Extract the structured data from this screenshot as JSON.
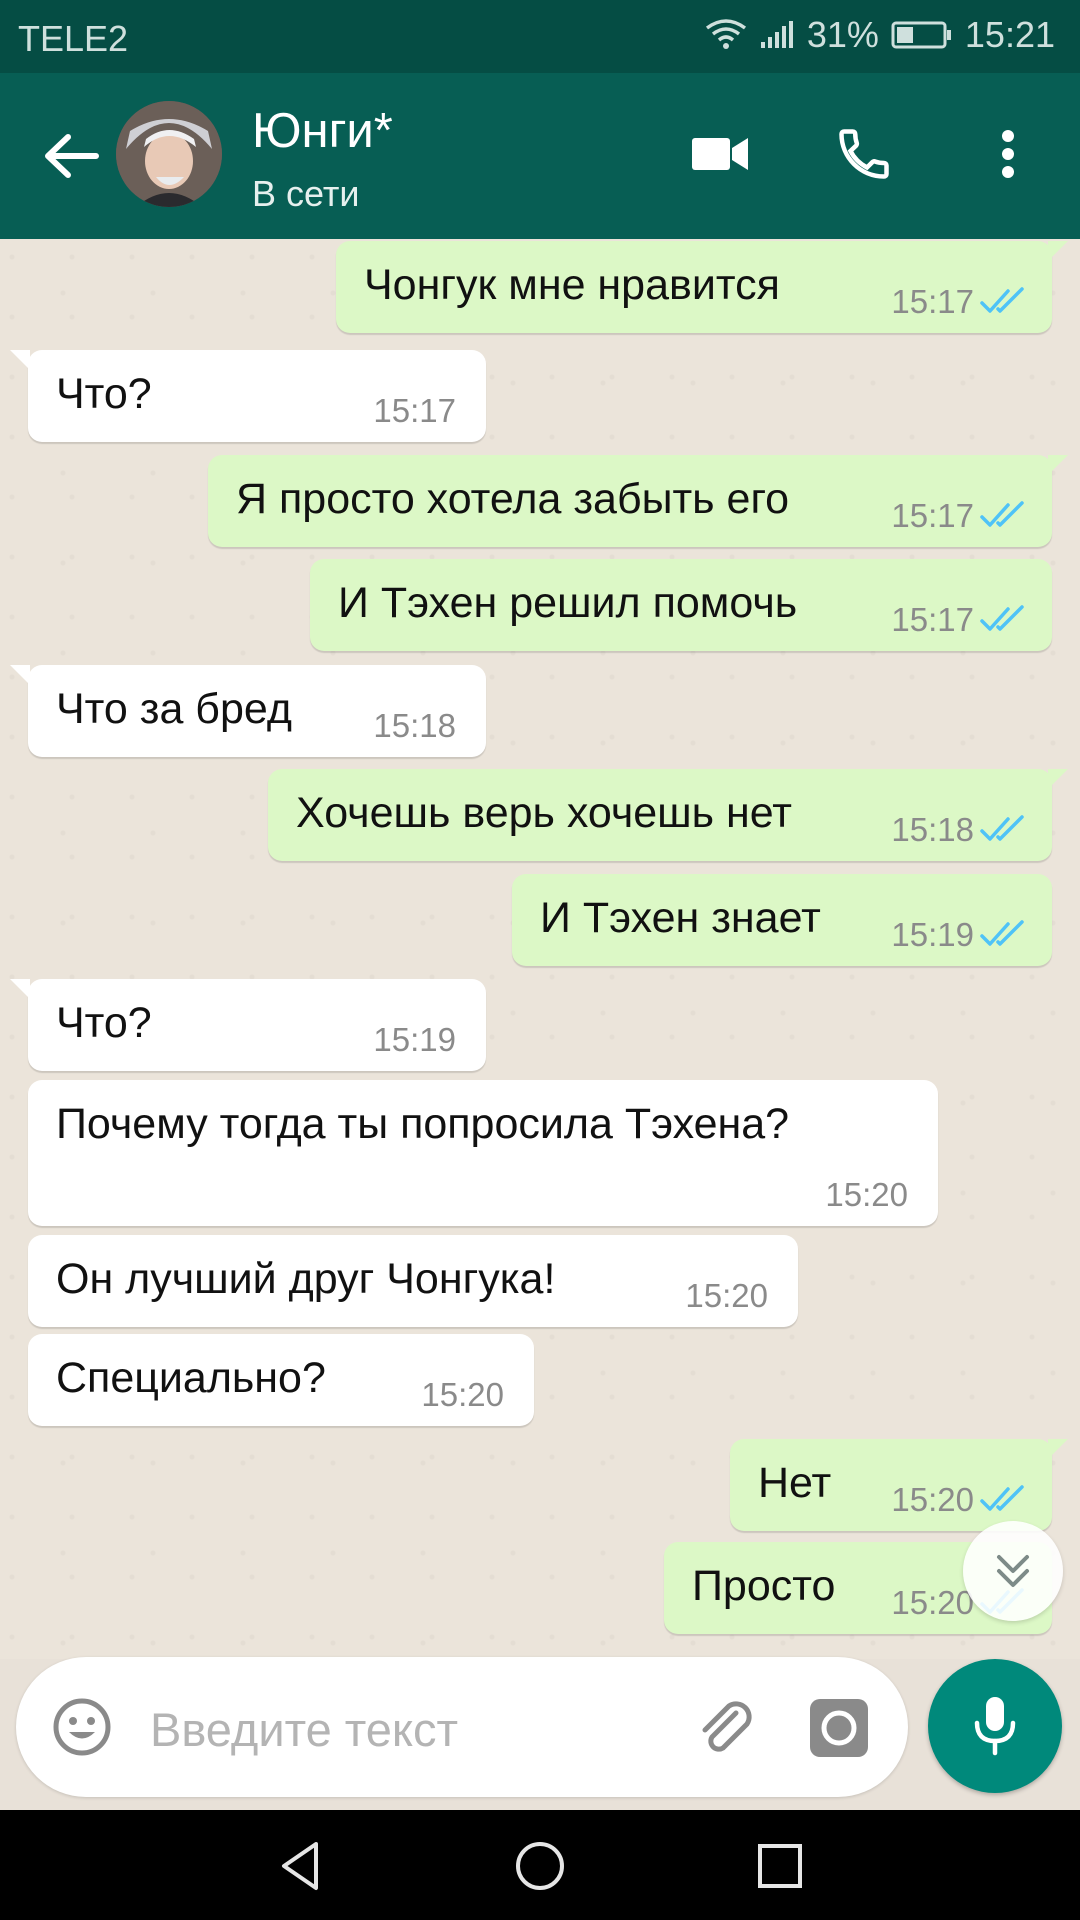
{
  "status_bar": {
    "carrier": "TELE2",
    "battery_percent": "31%",
    "time": "15:21"
  },
  "header": {
    "name": "Юнги*",
    "status": "В сети",
    "back_icon": "arrow-back-icon",
    "video_icon": "video-call-icon",
    "call_icon": "phone-icon",
    "menu_icon": "more-vert-icon"
  },
  "messages": [
    {
      "dir": "out",
      "text": "Чонгук мне нравится",
      "time": "15:17"
    },
    {
      "dir": "in",
      "text": "Что?",
      "time": "15:17"
    },
    {
      "dir": "out",
      "text": "Я просто хотела забыть его",
      "time": "15:17"
    },
    {
      "dir": "out",
      "text": "И Тэхен решил помочь",
      "time": "15:17"
    },
    {
      "dir": "in",
      "text": "Что за бред",
      "time": "15:18"
    },
    {
      "dir": "out",
      "text": "Хочешь верь хочешь нет",
      "time": "15:18"
    },
    {
      "dir": "out",
      "text": "И Тэхен знает",
      "time": "15:19"
    },
    {
      "dir": "in",
      "text": "Что?",
      "time": "15:19"
    },
    {
      "dir": "in",
      "text": "Почему тогда ты попросила Тэхена?",
      "time": "15:20"
    },
    {
      "dir": "in",
      "text": "Он лучший друг Чонгука!",
      "time": "15:20"
    },
    {
      "dir": "in",
      "text": "Специально?",
      "time": "15:20"
    },
    {
      "dir": "out",
      "text": "Нет",
      "time": "15:20"
    },
    {
      "dir": "out",
      "text": "Просто",
      "time": "15:20"
    }
  ],
  "input": {
    "placeholder": "Введите текст"
  },
  "colors": {
    "header": "#075e54",
    "status_bar": "#054d44",
    "outgoing_bubble": "#dcf8c6",
    "incoming_bubble": "#ffffff",
    "read_tick": "#4fc3f7",
    "mic_button": "#00897b"
  }
}
